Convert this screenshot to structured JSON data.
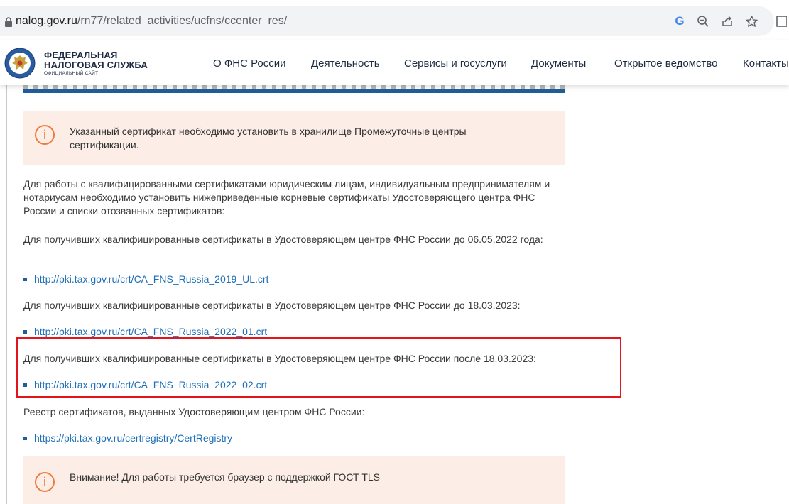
{
  "browser": {
    "url_host": "nalog.gov.ru",
    "url_path": "/rn77/related_activities/ucfns/ccenter_res/",
    "icons": [
      "lock-icon",
      "google-icon",
      "zoom-icon",
      "share-icon",
      "star-icon",
      "sidebar-icon"
    ],
    "google_letter": "G"
  },
  "header": {
    "brand_line1": "ФЕДЕРАЛЬНАЯ",
    "brand_line2": "НАЛОГОВАЯ СЛУЖБА",
    "brand_sub": "ОФИЦИАЛЬНЫЙ САЙТ",
    "nav": [
      {
        "label": "О ФНС России"
      },
      {
        "label": "Деятельность"
      },
      {
        "label": "Сервисы и госуслуги"
      },
      {
        "label": "Документы"
      },
      {
        "label": "Открытое ведомство"
      },
      {
        "label": "Контакты"
      }
    ]
  },
  "content": {
    "notice1": "Указанный сертификат необходимо установить в хранилище Промежуточные центры сертификации.",
    "intro": "Для работы с квалифицированными сертификатами юридическим лицам, индивидуальным предпринимателям и нотариусам необходимо установить нижеприведенные корневые сертификаты Удостоверяющего центра ФНС России и списки отозванных сертификатов:",
    "section1_text": "Для получивших квалифицированные сертификаты в Удостоверяющем центре ФНС России до 06.05.2022 года:",
    "section1_link": "http://pki.tax.gov.ru/crt/CA_FNS_Russia_2019_UL.crt",
    "section2_text": "Для получивших квалифицированные сертификаты в Удостоверяющем центре ФНС России до 18.03.2023:",
    "section2_link": "http://pki.tax.gov.ru/crt/CA_FNS_Russia_2022_01.crt",
    "section3_text": "Для получивших квалифицированные сертификаты в Удостоверяющем центре ФНС России после 18.03.2023:",
    "section3_link": "http://pki.tax.gov.ru/crt/CA_FNS_Russia_2022_02.crt",
    "registry_text": "Реестр сертификатов, выданных Удостоверяющим центром ФНС России:",
    "registry_link": "https://pki.tax.gov.ru/certregistry/CertRegistry",
    "notice2": "Внимание! Для работы требуется браузер с поддержкой ГОСТ TLS",
    "notice_icon_glyph": "i"
  },
  "colors": {
    "accent_blue": "#1e5f99",
    "link": "#1e6fb8",
    "notice_bg": "#fceee7",
    "notice_icon": "#f07a3a",
    "highlight_border": "#e3141b"
  }
}
